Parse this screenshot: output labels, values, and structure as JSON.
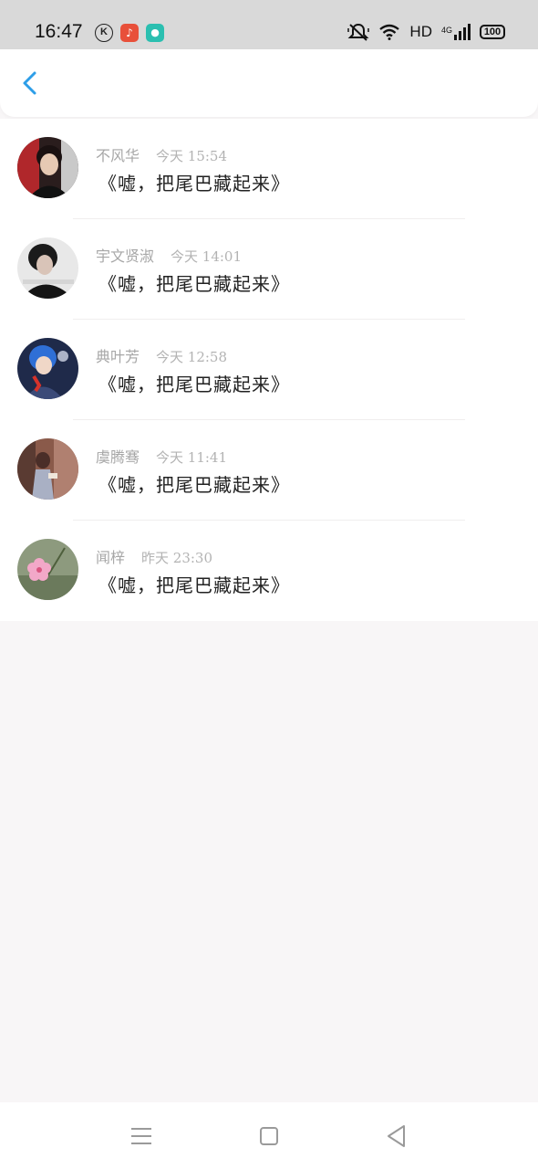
{
  "status_bar": {
    "time": "16:47",
    "k_icon_text": "K",
    "hd": "HD",
    "network": "4G",
    "battery": "100",
    "icons": [
      "k-app-icon",
      "music-app-icon",
      "chat-app-icon",
      "mute-icon",
      "wifi-icon",
      "signal-icon",
      "battery-icon"
    ]
  },
  "header": {
    "back_icon": "chevron-left-icon",
    "accent_color": "#2d9ee8"
  },
  "messages": [
    {
      "name": "不风华",
      "time": "今天 15:54",
      "text": "《嘘，把尾巴藏起来》"
    },
    {
      "name": "宇文贤淑",
      "time": "今天 14:01",
      "text": "《嘘，把尾巴藏起来》"
    },
    {
      "name": "典叶芳",
      "time": "今天 12:58",
      "text": "《嘘，把尾巴藏起来》"
    },
    {
      "name": "虞腾骞",
      "time": "今天 11:41",
      "text": "《嘘，把尾巴藏起来》"
    },
    {
      "name": "闻梓",
      "time": "昨天 23:30",
      "text": "《嘘，把尾巴藏起来》"
    }
  ],
  "nav_bar": {
    "icons": [
      "menu-icon",
      "home-icon",
      "back-triangle-icon"
    ]
  }
}
